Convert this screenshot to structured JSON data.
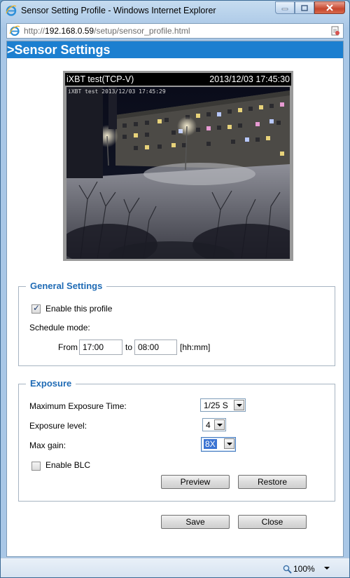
{
  "window": {
    "title": "Sensor Setting Profile - Windows Internet Explorer",
    "address_prefix": "http://",
    "address_host": "192.168.0.59",
    "address_path": "/setup/sensor_profile.html"
  },
  "page": {
    "header": ">Sensor Settings"
  },
  "video": {
    "caption": "iXBT test(TCP-V)",
    "datetime": "2013/12/03 17:45:30",
    "overlay_stamp": "iXBT test 2013/12/03 17:45:29"
  },
  "general": {
    "legend": "General Settings",
    "enable_label": "Enable this profile",
    "enable_checked": true,
    "schedule_label": "Schedule mode:",
    "from_label": "From",
    "from_value": "17:00",
    "to_label": "to",
    "to_value": "08:00",
    "unit_label": "[hh:mm]"
  },
  "exposure": {
    "legend": "Exposure",
    "max_time_label": "Maximum Exposure Time:",
    "max_time_value": "1/25 S",
    "level_label": "Exposure level:",
    "level_value": "4",
    "gain_label": "Max gain:",
    "gain_value": "8X",
    "blc_label": "Enable BLC",
    "blc_checked": false,
    "preview_label": "Preview",
    "restore_label": "Restore"
  },
  "footer": {
    "save_label": "Save",
    "close_label": "Close"
  },
  "statusbar": {
    "zoom": "100%"
  },
  "colors": {
    "header_bg": "#1c7fd0",
    "legend_text": "#1f6bb5",
    "close_btn": "#c6462d"
  }
}
